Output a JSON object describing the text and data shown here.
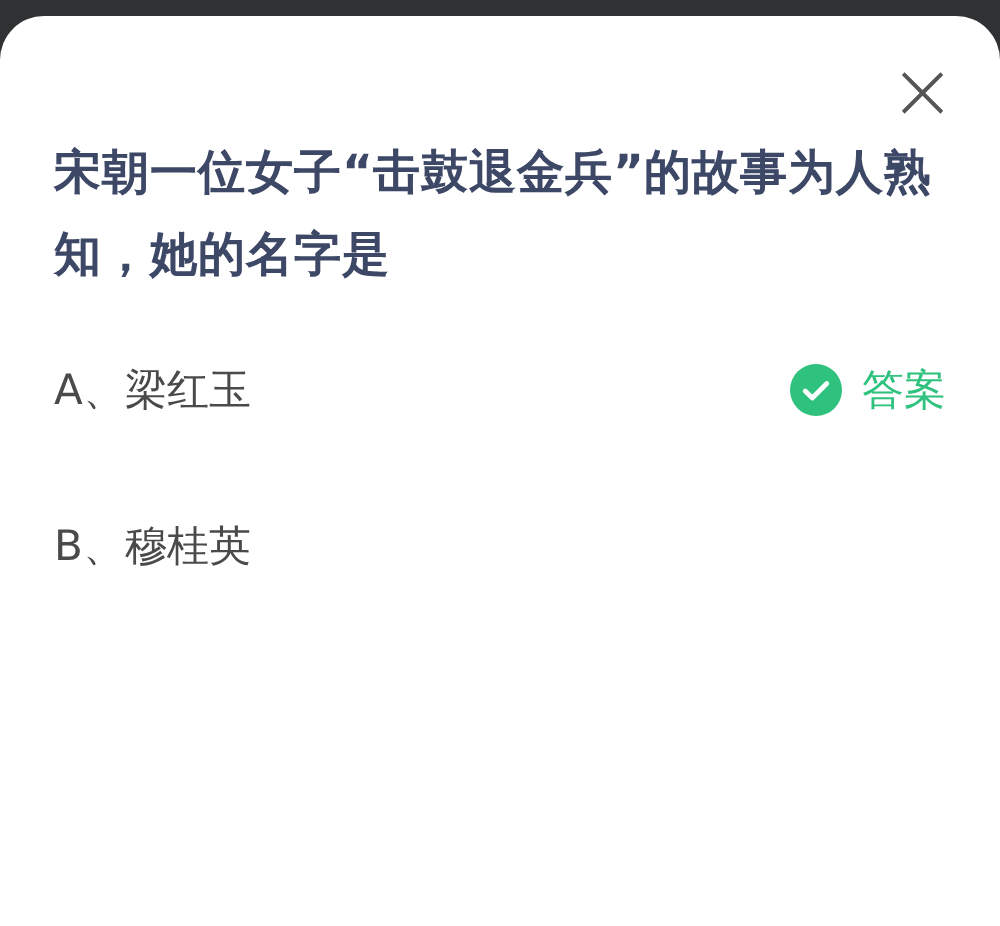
{
  "dialog": {
    "close_icon": "×",
    "question": "宋朝一位女子“击鼓退金兵”的故事为人熟知，她的名字是",
    "options": [
      {
        "text": "A、梁红玉",
        "correct": true,
        "answer_label": "答案"
      },
      {
        "text": "B、穆桂英",
        "correct": false
      }
    ]
  }
}
